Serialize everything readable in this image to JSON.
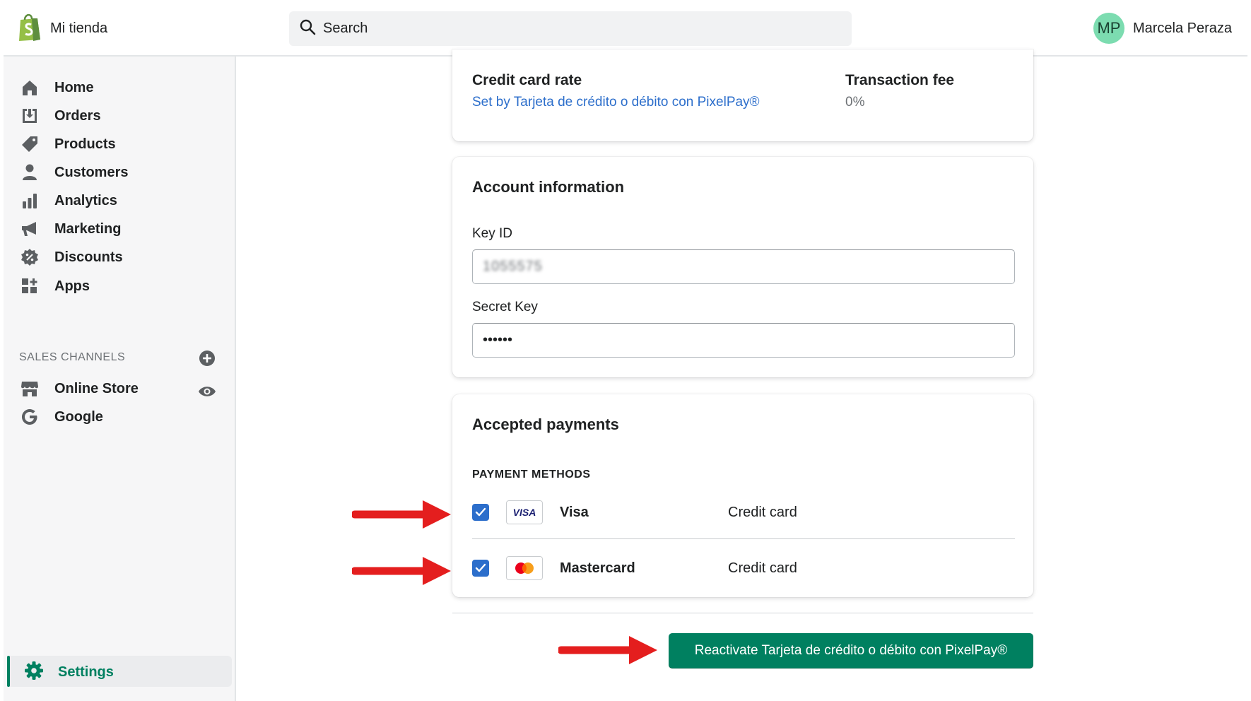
{
  "header": {
    "store_name": "Mi tienda",
    "search_placeholder": "Search",
    "user_initials": "MP",
    "user_name": "Marcela Peraza"
  },
  "sidebar": {
    "items": [
      {
        "label": "Home",
        "icon": "home-icon"
      },
      {
        "label": "Orders",
        "icon": "orders-icon"
      },
      {
        "label": "Products",
        "icon": "tag-icon"
      },
      {
        "label": "Customers",
        "icon": "person-icon"
      },
      {
        "label": "Analytics",
        "icon": "bar-chart-icon"
      },
      {
        "label": "Marketing",
        "icon": "megaphone-icon"
      },
      {
        "label": "Discounts",
        "icon": "discount-icon"
      },
      {
        "label": "Apps",
        "icon": "apps-icon"
      }
    ],
    "sales_channels_heading": "SALES CHANNELS",
    "channels": [
      {
        "label": "Online Store",
        "icon": "store-icon"
      },
      {
        "label": "Google",
        "icon": "google-icon"
      }
    ],
    "settings_label": "Settings"
  },
  "rate_card": {
    "credit_card_rate_label": "Credit card rate",
    "credit_card_rate_value": "Set by Tarjeta de crédito o débito con PixelPay®",
    "transaction_fee_label": "Transaction fee",
    "transaction_fee_value": "0%"
  },
  "account_card": {
    "title": "Account information",
    "key_id_label": "Key ID",
    "key_id_value": "1055575",
    "secret_key_label": "Secret Key",
    "secret_key_value": "••••••"
  },
  "payments_card": {
    "title": "Accepted payments",
    "methods_heading": "PAYMENT METHODS",
    "methods": [
      {
        "name": "Visa",
        "type": "Credit card",
        "checked": true,
        "logo_text": "VISA"
      },
      {
        "name": "Mastercard",
        "type": "Credit card",
        "checked": true
      }
    ]
  },
  "reactivate_button": "Reactivate Tarjeta de crédito o débito con PixelPay®",
  "colors": {
    "primary_green": "#008060",
    "link_blue": "#2c6ecb",
    "checkbox_blue": "#2c6ecb",
    "annotation_red": "#e41e1e",
    "avatar_green": "#7cdcb0"
  }
}
